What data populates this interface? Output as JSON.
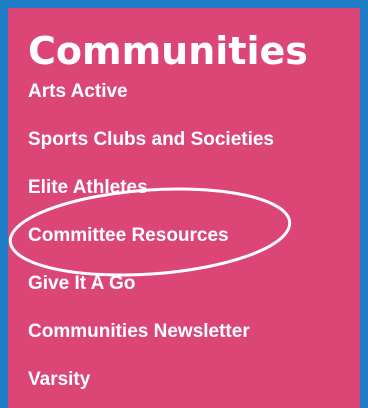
{
  "menu": {
    "title": "Communities",
    "items": [
      {
        "label": "Arts Active"
      },
      {
        "label": "Sports Clubs and Societies"
      },
      {
        "label": "Elite Athletes"
      },
      {
        "label": "Committee Resources"
      },
      {
        "label": "Give It A Go"
      },
      {
        "label": "Communities Newsletter"
      },
      {
        "label": "Varsity"
      }
    ]
  },
  "colors": {
    "background": "#1e7fc6",
    "panel": "#dc4677",
    "text": "#ffffff",
    "annotation": "#ffffff"
  }
}
